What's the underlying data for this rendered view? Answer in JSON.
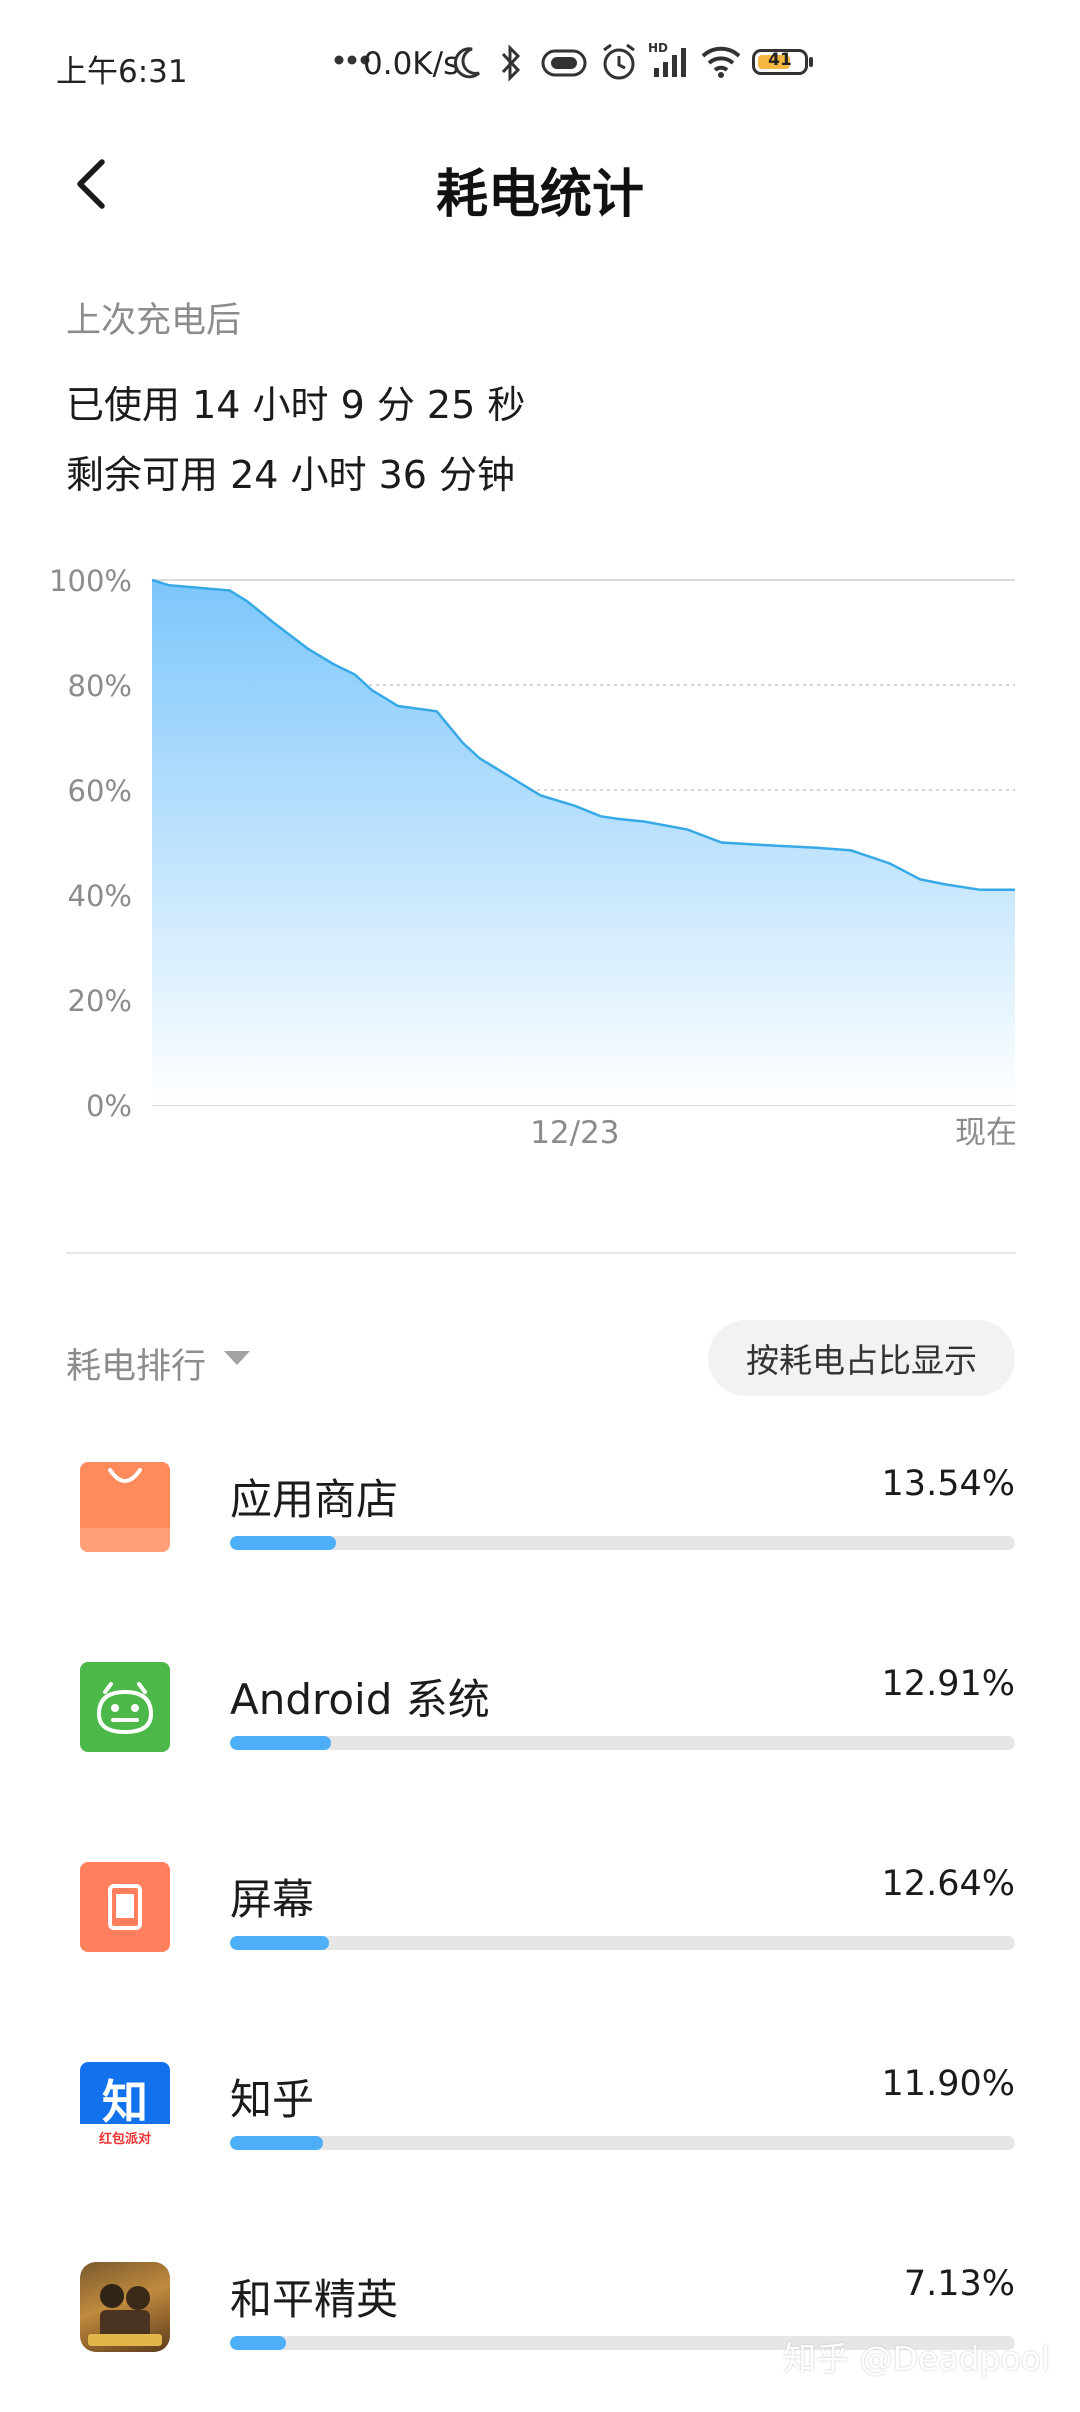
{
  "status_bar": {
    "time": "上午6:31",
    "net_speed": "0.0K/s",
    "battery_level": "41",
    "icons": [
      "more-dots-icon",
      "moon-icon",
      "bluetooth-icon",
      "vibrate-icon",
      "alarm-icon",
      "hd-signal-icon",
      "wifi-icon",
      "battery-icon"
    ]
  },
  "header": {
    "title": "耗电统计",
    "back_icon": "chevron-left-icon"
  },
  "summary": {
    "since_label": "上次充电后",
    "used": "已使用 14 小时 9 分 25 秒",
    "remaining": "剩余可用 24 小时 36 分钟"
  },
  "chart_data": {
    "type": "area",
    "title": "",
    "xlabel": "",
    "ylabel": "",
    "y_tick_labels": [
      "100%",
      "80%",
      "60%",
      "40%",
      "20%",
      "0%"
    ],
    "x_tick_labels": [
      "12/23",
      "现在"
    ],
    "ylim": [
      0,
      100
    ],
    "y_unit": "%",
    "grid": true,
    "x": [
      0,
      0.02,
      0.09,
      0.11,
      0.14,
      0.18,
      0.21,
      0.235,
      0.255,
      0.285,
      0.33,
      0.36,
      0.38,
      0.4,
      0.43,
      0.45,
      0.49,
      0.52,
      0.54,
      0.57,
      0.62,
      0.66,
      0.71,
      0.77,
      0.81,
      0.855,
      0.89,
      0.92,
      0.96,
      1.0
    ],
    "values": [
      100,
      99,
      98,
      96,
      92,
      87,
      84,
      82,
      79,
      76,
      75,
      69,
      66,
      64,
      61,
      59,
      57,
      55,
      54.5,
      54,
      52.5,
      50,
      49.5,
      49,
      48.5,
      46,
      43,
      42,
      41,
      41
    ],
    "line_color": "#36a9e6",
    "fill_top_color": "#7cc6fb",
    "fill_bottom_color": "#ffffff"
  },
  "ranking": {
    "label": "耗电排行",
    "caret_icon": "caret-down-icon",
    "toggle_label": "按耗电占比显示",
    "apps": [
      {
        "name": "应用商店",
        "percent": "13.54%",
        "fraction": 0.1354,
        "icon": "app-store-icon"
      },
      {
        "name": "Android 系统",
        "percent": "12.91%",
        "fraction": 0.1291,
        "icon": "android-icon"
      },
      {
        "name": "屏幕",
        "percent": "12.64%",
        "fraction": 0.1264,
        "icon": "screen-icon"
      },
      {
        "name": "知乎",
        "percent": "11.90%",
        "fraction": 0.119,
        "icon": "zhihu-icon",
        "icon_text": "知",
        "icon_subtext": "红包派对"
      },
      {
        "name": "和平精英",
        "percent": "7.13%",
        "fraction": 0.0713,
        "icon": "peace-elite-icon"
      }
    ]
  },
  "colors": {
    "bar_fill": "#4eaef7",
    "bar_track": "#e6e6e6",
    "app_store": "#ff8a5b",
    "android": "#4cb84a",
    "screen": "#ff7f5e",
    "zhihu": "#1272ed"
  },
  "watermark": "知乎 @Deadpool"
}
